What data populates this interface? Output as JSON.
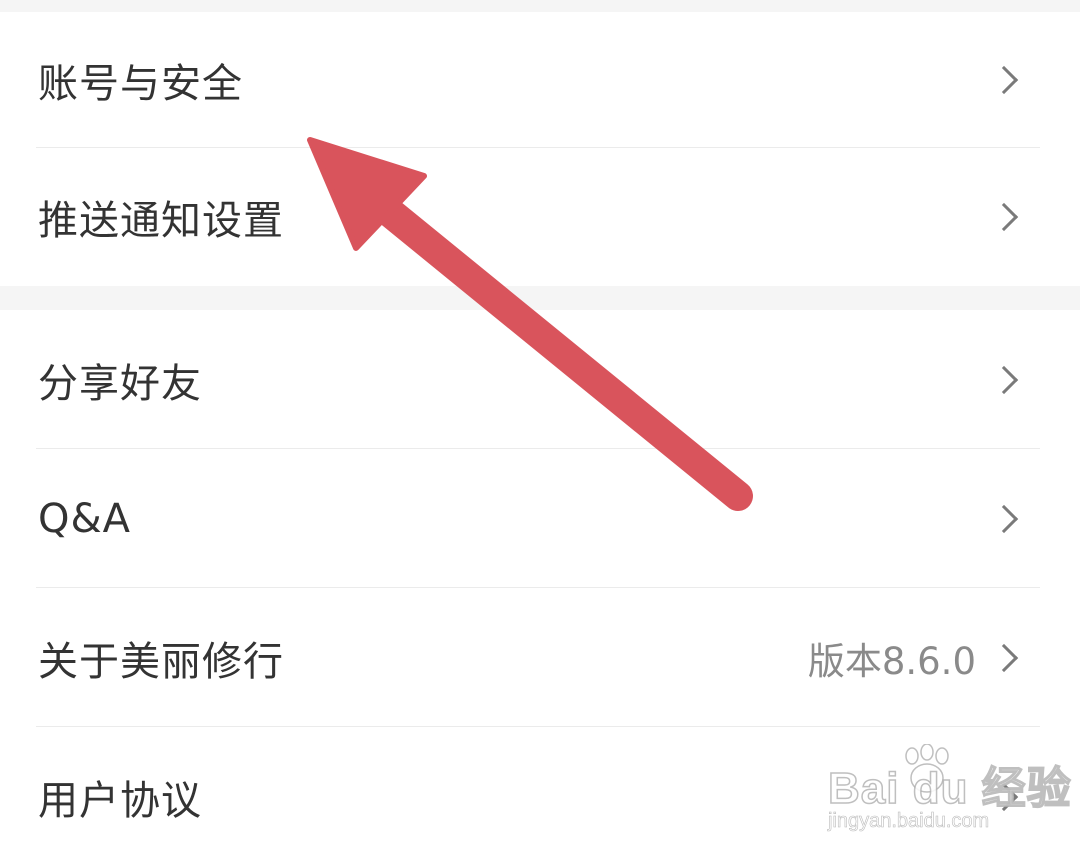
{
  "settings": {
    "group1": [
      {
        "label": "账号与安全"
      },
      {
        "label": "推送通知设置"
      }
    ],
    "group2": [
      {
        "label": "分享好友"
      },
      {
        "label": "Q&A"
      },
      {
        "label": "关于美丽修行",
        "value": "版本8.6.0"
      },
      {
        "label": "用户协议"
      }
    ]
  },
  "annotation": {
    "arrow_color": "#d9545c",
    "points_to": "账号与安全"
  },
  "watermark": {
    "logo": "Bai du 经验",
    "url": "jingyan.baidu.com"
  },
  "colors": {
    "background": "#ffffff",
    "separator": "#f5f5f5",
    "text": "#333333",
    "secondary_text": "#8a8a8a"
  }
}
